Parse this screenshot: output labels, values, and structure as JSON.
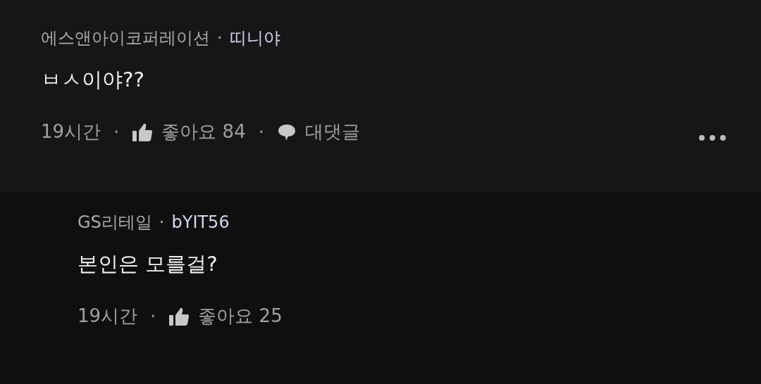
{
  "comments": [
    {
      "kind": "comment",
      "company": "에스앤아이코퍼레이션",
      "author_separator": "·",
      "nickname": "띠니야",
      "text": "ㅂㅅ이야??",
      "meta": [
        {
          "kind": "time",
          "text": "19시간"
        },
        {
          "kind": "separator",
          "text": "·"
        },
        {
          "kind": "like",
          "text": "좋아요 84"
        },
        {
          "kind": "separator",
          "text": "·"
        },
        {
          "kind": "reply",
          "text": "대댓글"
        }
      ],
      "more_menu": true
    },
    {
      "kind": "reply",
      "company": "GS리테일",
      "author_separator": "·",
      "nickname": "bYIT56",
      "text": "본인은 모를걸?",
      "meta": [
        {
          "kind": "time",
          "text": "19시간"
        },
        {
          "kind": "separator",
          "text": "·"
        },
        {
          "kind": "like",
          "text": "좋아요 25"
        }
      ],
      "more_menu": false
    }
  ]
}
